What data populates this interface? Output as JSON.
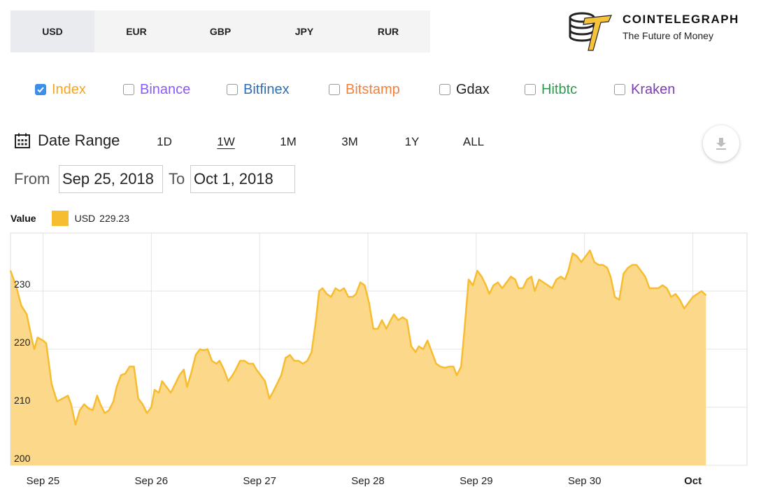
{
  "currency_tabs": [
    {
      "label": "USD",
      "active": true
    },
    {
      "label": "EUR",
      "active": false
    },
    {
      "label": "GBP",
      "active": false
    },
    {
      "label": "JPY",
      "active": false
    },
    {
      "label": "RUR",
      "active": false
    }
  ],
  "brand": {
    "name": "COINTELEGRAPH",
    "tagline": "The Future of Money",
    "color": "#f7c33a"
  },
  "exchanges": [
    {
      "label": "Index",
      "checked": true,
      "color": "#f5a623"
    },
    {
      "label": "Binance",
      "checked": false,
      "color": "#8b5cf6"
    },
    {
      "label": "Bitfinex",
      "checked": false,
      "color": "#2f6fb5"
    },
    {
      "label": "Bitstamp",
      "checked": false,
      "color": "#f0823f"
    },
    {
      "label": "Gdax",
      "checked": false,
      "color": "#222222"
    },
    {
      "label": "Hitbtc",
      "checked": false,
      "color": "#2e9a4f"
    },
    {
      "label": "Kraken",
      "checked": false,
      "color": "#7c3fb0"
    }
  ],
  "date_range": {
    "label": "Date Range",
    "options": [
      "1D",
      "1W",
      "1M",
      "3M",
      "1Y",
      "ALL"
    ],
    "active": "1W",
    "from_label": "From",
    "to_label": "To",
    "from_value": "Sep 25, 2018",
    "to_value": "Oct 1, 2018"
  },
  "legend": {
    "title": "Value",
    "series": "USD",
    "value": "229.23"
  },
  "chart_data": {
    "type": "area",
    "series": [
      {
        "name": "USD",
        "color": "#f7bd30",
        "fill": "#fbd88a"
      }
    ],
    "x_ticks": [
      {
        "label": "Sep 25",
        "bold": false
      },
      {
        "label": "Sep 26",
        "bold": false
      },
      {
        "label": "Sep 27",
        "bold": false
      },
      {
        "label": "Sep 28",
        "bold": false
      },
      {
        "label": "Sep 29",
        "bold": false
      },
      {
        "label": "Sep 30",
        "bold": false
      },
      {
        "label": "Oct",
        "bold": true
      }
    ],
    "y_ticks": [
      200,
      210,
      220,
      230
    ],
    "ylim": [
      200,
      240
    ],
    "xlim": [
      -0.3,
      6.5
    ],
    "grid": true,
    "points": [
      [
        -0.3,
        233.5
      ],
      [
        -0.25,
        231.0
      ],
      [
        -0.2,
        227.5
      ],
      [
        -0.15,
        226.0
      ],
      [
        -0.1,
        221.5
      ],
      [
        -0.08,
        220.0
      ],
      [
        -0.05,
        222.0
      ],
      [
        0.0,
        221.5
      ],
      [
        0.03,
        221.0
      ],
      [
        0.08,
        214.0
      ],
      [
        0.13,
        211.0
      ],
      [
        0.18,
        211.5
      ],
      [
        0.23,
        212.0
      ],
      [
        0.26,
        210.5
      ],
      [
        0.3,
        207.0
      ],
      [
        0.34,
        209.5
      ],
      [
        0.38,
        210.5
      ],
      [
        0.42,
        209.8
      ],
      [
        0.46,
        209.5
      ],
      [
        0.5,
        212.0
      ],
      [
        0.53,
        210.5
      ],
      [
        0.57,
        209.0
      ],
      [
        0.61,
        209.5
      ],
      [
        0.65,
        211.0
      ],
      [
        0.68,
        213.5
      ],
      [
        0.72,
        215.5
      ],
      [
        0.76,
        215.8
      ],
      [
        0.8,
        217.0
      ],
      [
        0.84,
        217.0
      ],
      [
        0.88,
        211.5
      ],
      [
        0.92,
        210.5
      ],
      [
        0.96,
        209.0
      ],
      [
        1.0,
        210.0
      ],
      [
        1.03,
        213.0
      ],
      [
        1.07,
        212.5
      ],
      [
        1.1,
        214.5
      ],
      [
        1.14,
        213.5
      ],
      [
        1.18,
        212.5
      ],
      [
        1.22,
        214.0
      ],
      [
        1.26,
        215.5
      ],
      [
        1.3,
        216.5
      ],
      [
        1.33,
        213.5
      ],
      [
        1.37,
        216.0
      ],
      [
        1.41,
        219.0
      ],
      [
        1.45,
        220.0
      ],
      [
        1.48,
        219.8
      ],
      [
        1.52,
        220.0
      ],
      [
        1.56,
        218.0
      ],
      [
        1.6,
        217.5
      ],
      [
        1.63,
        218.0
      ],
      [
        1.67,
        216.5
      ],
      [
        1.71,
        214.5
      ],
      [
        1.75,
        215.5
      ],
      [
        1.78,
        216.5
      ],
      [
        1.82,
        218.0
      ],
      [
        1.86,
        218.0
      ],
      [
        1.9,
        217.5
      ],
      [
        1.94,
        217.5
      ],
      [
        1.97,
        216.5
      ],
      [
        2.01,
        215.5
      ],
      [
        2.05,
        214.5
      ],
      [
        2.09,
        211.5
      ],
      [
        2.12,
        212.5
      ],
      [
        2.16,
        214.0
      ],
      [
        2.2,
        215.5
      ],
      [
        2.24,
        218.5
      ],
      [
        2.28,
        219.0
      ],
      [
        2.32,
        218.0
      ],
      [
        2.36,
        218.0
      ],
      [
        2.4,
        217.5
      ],
      [
        2.44,
        218.0
      ],
      [
        2.48,
        219.5
      ],
      [
        2.52,
        225.0
      ],
      [
        2.55,
        230.0
      ],
      [
        2.58,
        230.5
      ],
      [
        2.62,
        229.5
      ],
      [
        2.66,
        229.0
      ],
      [
        2.7,
        230.5
      ],
      [
        2.74,
        230.0
      ],
      [
        2.78,
        230.5
      ],
      [
        2.82,
        229.0
      ],
      [
        2.86,
        229.0
      ],
      [
        2.89,
        229.5
      ],
      [
        2.93,
        231.5
      ],
      [
        2.97,
        231.0
      ],
      [
        3.01,
        228.0
      ],
      [
        3.05,
        223.5
      ],
      [
        3.09,
        223.5
      ],
      [
        3.13,
        225.0
      ],
      [
        3.17,
        223.5
      ],
      [
        3.21,
        225.0
      ],
      [
        3.24,
        226.0
      ],
      [
        3.28,
        225.0
      ],
      [
        3.32,
        225.5
      ],
      [
        3.36,
        225.0
      ],
      [
        3.4,
        220.5
      ],
      [
        3.44,
        219.5
      ],
      [
        3.47,
        220.5
      ],
      [
        3.51,
        220.0
      ],
      [
        3.55,
        221.5
      ],
      [
        3.59,
        219.5
      ],
      [
        3.63,
        217.5
      ],
      [
        3.67,
        217.0
      ],
      [
        3.71,
        216.8
      ],
      [
        3.75,
        217.0
      ],
      [
        3.79,
        217.0
      ],
      [
        3.82,
        215.5
      ],
      [
        3.86,
        217.0
      ],
      [
        3.89,
        223.0
      ],
      [
        3.93,
        232.0
      ],
      [
        3.97,
        231.0
      ],
      [
        4.01,
        233.5
      ],
      [
        4.05,
        232.5
      ],
      [
        4.09,
        231.0
      ],
      [
        4.12,
        229.5
      ],
      [
        4.16,
        231.0
      ],
      [
        4.2,
        231.5
      ],
      [
        4.24,
        230.5
      ],
      [
        4.28,
        231.5
      ],
      [
        4.32,
        232.5
      ],
      [
        4.36,
        232.0
      ],
      [
        4.39,
        230.5
      ],
      [
        4.43,
        230.5
      ],
      [
        4.47,
        232.0
      ],
      [
        4.51,
        232.5
      ],
      [
        4.54,
        230.0
      ],
      [
        4.58,
        232.0
      ],
      [
        4.62,
        231.5
      ],
      [
        4.66,
        231.0
      ],
      [
        4.7,
        230.5
      ],
      [
        4.74,
        232.0
      ],
      [
        4.78,
        232.5
      ],
      [
        4.82,
        232.0
      ],
      [
        4.85,
        233.5
      ],
      [
        4.89,
        236.5
      ],
      [
        4.93,
        236.0
      ],
      [
        4.97,
        235.0
      ],
      [
        5.01,
        236.0
      ],
      [
        5.05,
        237.0
      ],
      [
        5.09,
        235.0
      ],
      [
        5.13,
        234.5
      ],
      [
        5.17,
        234.5
      ],
      [
        5.21,
        234.0
      ],
      [
        5.24,
        232.5
      ],
      [
        5.28,
        229.0
      ],
      [
        5.32,
        228.5
      ],
      [
        5.36,
        233.0
      ],
      [
        5.4,
        234.0
      ],
      [
        5.44,
        234.5
      ],
      [
        5.48,
        234.5
      ],
      [
        5.52,
        233.5
      ],
      [
        5.56,
        232.5
      ],
      [
        5.6,
        230.5
      ],
      [
        5.64,
        230.5
      ],
      [
        5.68,
        230.5
      ],
      [
        5.72,
        231.0
      ],
      [
        5.76,
        230.5
      ],
      [
        5.8,
        229.0
      ],
      [
        5.84,
        229.5
      ],
      [
        5.88,
        228.5
      ],
      [
        5.92,
        227.0
      ],
      [
        5.96,
        228.0
      ],
      [
        6.0,
        229.0
      ],
      [
        6.04,
        229.5
      ],
      [
        6.08,
        230.0
      ],
      [
        6.12,
        229.3
      ]
    ]
  }
}
